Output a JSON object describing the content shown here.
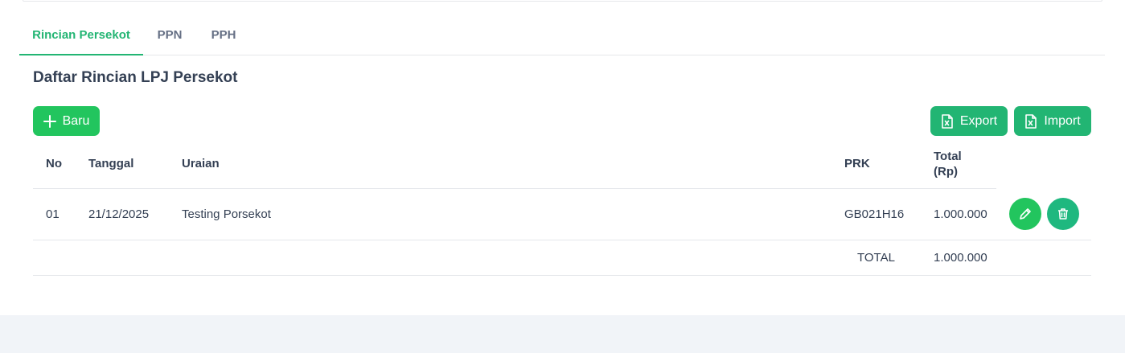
{
  "tabs": [
    {
      "label": "Rincian Persekot",
      "active": true
    },
    {
      "label": "PPN",
      "active": false
    },
    {
      "label": "PPH",
      "active": false
    }
  ],
  "page_title": "Daftar Rincian LPJ Persekot",
  "toolbar": {
    "new_label": "Baru",
    "export_label": "Export",
    "import_label": "Import"
  },
  "table": {
    "headers": {
      "no": "No",
      "tanggal": "Tanggal",
      "uraian": "Uraian",
      "prk": "PRK",
      "total_line1": "Total",
      "total_line2": "(Rp)"
    },
    "rows": [
      {
        "no": "01",
        "tanggal": "21/12/2025",
        "uraian": "Testing Porsekot",
        "prk": "GB021H16",
        "total": "1.000.000"
      }
    ],
    "total_label": "TOTAL",
    "total_value": "1.000.000"
  },
  "colors": {
    "accent": "#22b573",
    "text": "#344054",
    "muted": "#667085",
    "footer_bg": "#f1f4f8"
  }
}
